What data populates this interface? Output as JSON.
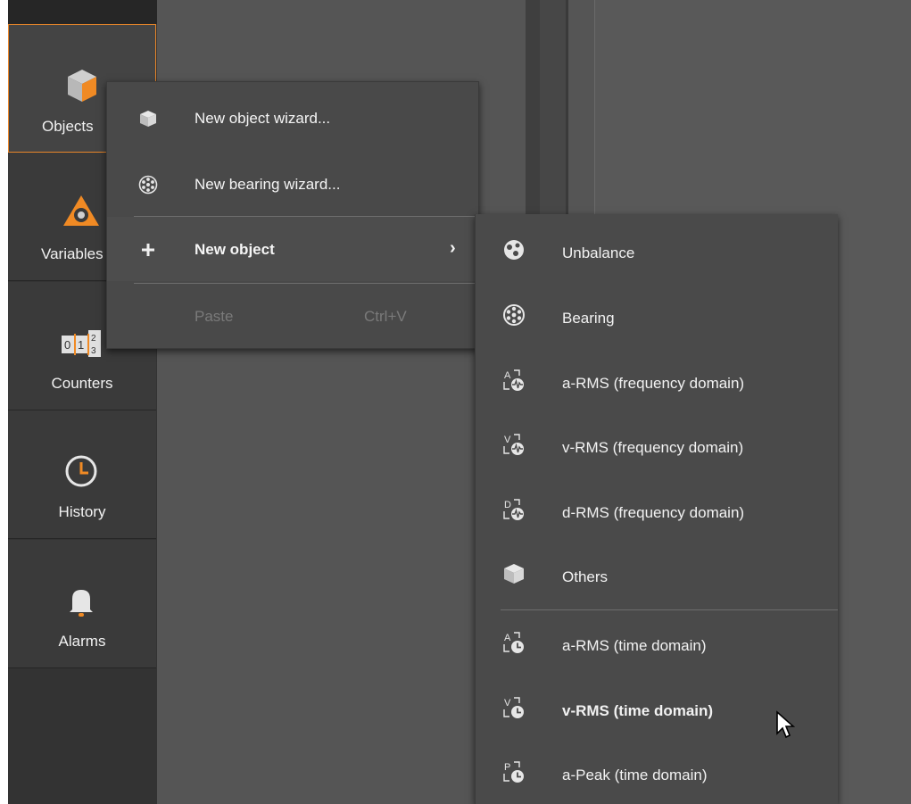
{
  "sidebar": {
    "items": [
      {
        "label": "Objects",
        "icon": "cube-orange-icon",
        "active": true
      },
      {
        "label": "Variables",
        "icon": "variables-icon"
      },
      {
        "label": "Counters",
        "icon": "counter-digits-icon"
      },
      {
        "label": "History",
        "icon": "clock-icon"
      },
      {
        "label": "Alarms",
        "icon": "bell-icon"
      }
    ]
  },
  "context_menu": {
    "items": [
      {
        "label": "New object wizard...",
        "icon": "cube-icon"
      },
      {
        "label": "New bearing wizard...",
        "icon": "bearing-icon"
      },
      {
        "label": "New object",
        "icon": "plus-icon",
        "has_submenu": true
      },
      {
        "label": "Paste",
        "shortcut": "Ctrl+V",
        "disabled": true
      }
    ]
  },
  "submenu": {
    "items": [
      {
        "label": "Unbalance",
        "icon": "unbalance-icon"
      },
      {
        "label": "Bearing",
        "icon": "bearing-icon"
      },
      {
        "label": "a-RMS (frequency domain)",
        "icon": "a-rms-frequency-icon",
        "letter": "A"
      },
      {
        "label": "v-RMS (frequency domain)",
        "icon": "v-rms-frequency-icon",
        "letter": "V"
      },
      {
        "label": "d-RMS (frequency domain)",
        "icon": "d-rms-frequency-icon",
        "letter": "D"
      },
      {
        "label": "Others",
        "icon": "cube-icon"
      },
      {
        "label": "a-RMS (time domain)",
        "icon": "a-rms-time-icon",
        "letter": "A"
      },
      {
        "label": "v-RMS (time domain)",
        "icon": "v-rms-time-icon",
        "letter": "V",
        "bold": true
      },
      {
        "label": "a-Peak (time domain)",
        "icon": "a-peak-time-icon",
        "letter": "P"
      }
    ]
  },
  "colors": {
    "accent": "#e8862a",
    "menu_bg": "#494949",
    "sidebar_bg": "#3a3a3a"
  }
}
